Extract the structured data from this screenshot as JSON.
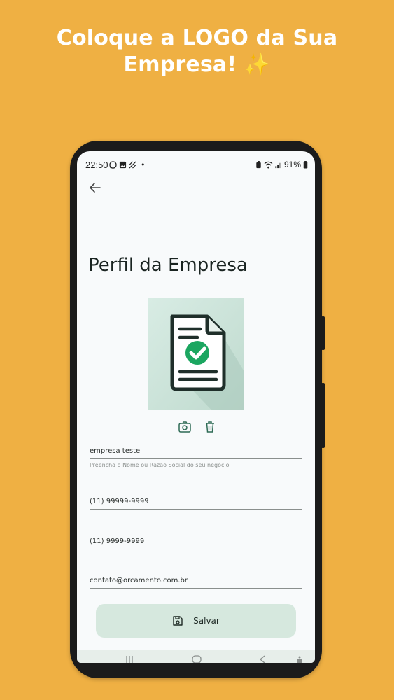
{
  "promo": {
    "line1": "Coloque a LOGO da Sua",
    "line2": "Empresa!",
    "sparkle": "✨"
  },
  "status_bar": {
    "time": "22:50",
    "battery": "91%",
    "dot": "•"
  },
  "page": {
    "title": "Perfil da Empresa"
  },
  "form": {
    "company_name": "empresa teste",
    "company_name_helper": "Preencha o Nome ou Razão Social do seu negócio",
    "phone1": "(11) 99999-9999",
    "phone2": "(11) 9999-9999",
    "email": "contato@orcamento.com.br"
  },
  "actions": {
    "save_label": "Salvar"
  },
  "icons": {
    "back": "arrow-left-icon",
    "camera": "camera-icon",
    "delete": "trash-icon",
    "save": "floppy-disk-icon"
  },
  "colors": {
    "background": "#EFB043",
    "screen": "#F8FAFB",
    "accent": "#2E6B55",
    "save_button": "#D6E8DE",
    "check": "#1BA660"
  }
}
